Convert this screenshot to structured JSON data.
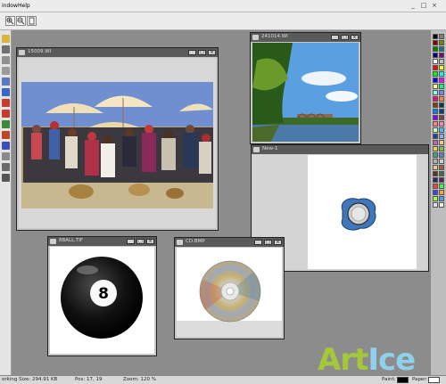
{
  "menubar": {
    "items": [
      {
        "label": "indow"
      },
      {
        "label": "Help"
      }
    ],
    "controls": {
      "minimize": "_",
      "maximize": "□",
      "close": "×"
    }
  },
  "toolbar": {
    "buttons": [
      {
        "icon": "zoom-in-icon"
      },
      {
        "icon": "zoom-out-icon"
      },
      {
        "icon": "page-icon"
      }
    ]
  },
  "toolbox": {
    "tools": [
      {
        "icon": "open-icon",
        "color": "#d9b640"
      },
      {
        "icon": "arrow-icon",
        "color": "#707070"
      },
      {
        "icon": "select-rect-icon",
        "color": "#909090"
      },
      {
        "icon": "lasso-icon",
        "color": "#9a9a9a"
      },
      {
        "icon": "magnifier-icon",
        "color": "#5a78c0"
      },
      {
        "icon": "eyedropper-icon",
        "color": "#3a66c8"
      },
      {
        "icon": "pencil-icon",
        "color": "#c83a30"
      },
      {
        "icon": "brush-icon",
        "color": "#c83a30"
      },
      {
        "icon": "clone-icon",
        "color": "#3a8a3a"
      },
      {
        "icon": "bucket-icon",
        "color": "#c0442c"
      },
      {
        "icon": "eraser-icon",
        "color": "#3a50b8"
      },
      {
        "icon": "stamp-icon",
        "color": "#8a8a8a"
      },
      {
        "icon": "shapes-icon",
        "color": "#6a6a6a"
      },
      {
        "icon": "text-icon",
        "color": "#555555"
      }
    ]
  },
  "palette": {
    "colors": [
      "#000000",
      "#808080",
      "#800000",
      "#808000",
      "#008000",
      "#008080",
      "#000080",
      "#800080",
      "#ffffff",
      "#c0c0c0",
      "#ff0000",
      "#ffff00",
      "#00ff00",
      "#00ffff",
      "#0000ff",
      "#ff00ff",
      "#ffff80",
      "#00ff80",
      "#80ffff",
      "#8080ff",
      "#ff0080",
      "#ff8040",
      "#804000",
      "#004040",
      "#0080ff",
      "#004080",
      "#8000ff",
      "#804040",
      "#ff8080",
      "#ff80c0",
      "#c0ffc0",
      "#40c0ff",
      "#2040a0",
      "#a0a0ff",
      "#c060c0",
      "#ffc080",
      "#e8d050",
      "#80c040",
      "#40a080",
      "#6080c0",
      "#b0b0b0",
      "#d0d0d0",
      "#f0c0a0",
      "#a06040",
      "#603020",
      "#407040",
      "#203060",
      "#602060",
      "#ff4040",
      "#40ff40",
      "#4040ff",
      "#ffa040",
      "#a0ff40",
      "#40a0ff",
      "#e0e0e0",
      "#f0f0f0"
    ]
  },
  "windows": {
    "w1": {
      "title": "15009.WI",
      "icon": "image-document-icon",
      "image": "market-crowd-photo"
    },
    "w2": {
      "title": "241014.WI",
      "icon": "image-document-icon",
      "image": "river-bridge-landscape-photo"
    },
    "w3": {
      "title": "New-1",
      "icon": "image-document-icon",
      "image": "coin-shape-drawing"
    },
    "w4": {
      "title": "8BALL.TIF",
      "icon": "image-document-icon",
      "image": "eight-ball-photo",
      "ball_number": "8"
    },
    "w5": {
      "title": "CD.BMP",
      "icon": "image-document-icon",
      "image": "compact-disc-photo"
    },
    "controls": {
      "minimize": "_",
      "maximize": "□",
      "close": "×"
    }
  },
  "statusbar": {
    "working_size": "orking Size: 294.91 KB",
    "position": "Pos: 17, 19",
    "zoom": "Zoom: 120 %",
    "paint_label": "Paint:",
    "paint_color": "#000000",
    "paper_label": "Paper:",
    "paper_color": "#ffffff"
  },
  "watermark": {
    "part1": "Art",
    "part2": "Ice"
  }
}
